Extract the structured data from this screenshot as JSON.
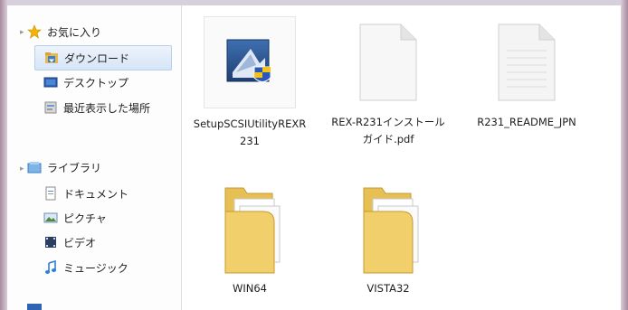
{
  "nav": {
    "favorites_label": "お気に入り",
    "favorites": [
      {
        "label": "ダウンロード",
        "icon": "downloads-folder-icon",
        "selected": true
      },
      {
        "label": "デスクトップ",
        "icon": "desktop-icon",
        "selected": false
      },
      {
        "label": "最近表示した場所",
        "icon": "recent-places-icon",
        "selected": false
      }
    ],
    "library_label": "ライブラリ",
    "libraries": [
      {
        "label": "ドキュメント",
        "icon": "documents-icon"
      },
      {
        "label": "ピクチャ",
        "icon": "pictures-icon"
      },
      {
        "label": "ビデオ",
        "icon": "videos-icon"
      },
      {
        "label": "ミュージック",
        "icon": "music-icon"
      }
    ]
  },
  "files": [
    {
      "name": "SetupSCSIUtilityREXR231",
      "type": "installer",
      "icon": "setup-installer-icon"
    },
    {
      "name": "REX-R231インストールガイド.pdf",
      "type": "pdf",
      "icon": "pdf-document-icon"
    },
    {
      "name": "R231_README_JPN",
      "type": "text",
      "icon": "text-document-icon"
    },
    {
      "name": "WIN64",
      "type": "folder",
      "icon": "folder-icon"
    },
    {
      "name": "VISTA32",
      "type": "folder",
      "icon": "folder-icon"
    }
  ],
  "colors": {
    "selection_bg": "#d6e5f7",
    "selection_border": "#b7d0ee",
    "folder_yellow": "#f0cf6b",
    "star_gold": "#f4b400"
  }
}
